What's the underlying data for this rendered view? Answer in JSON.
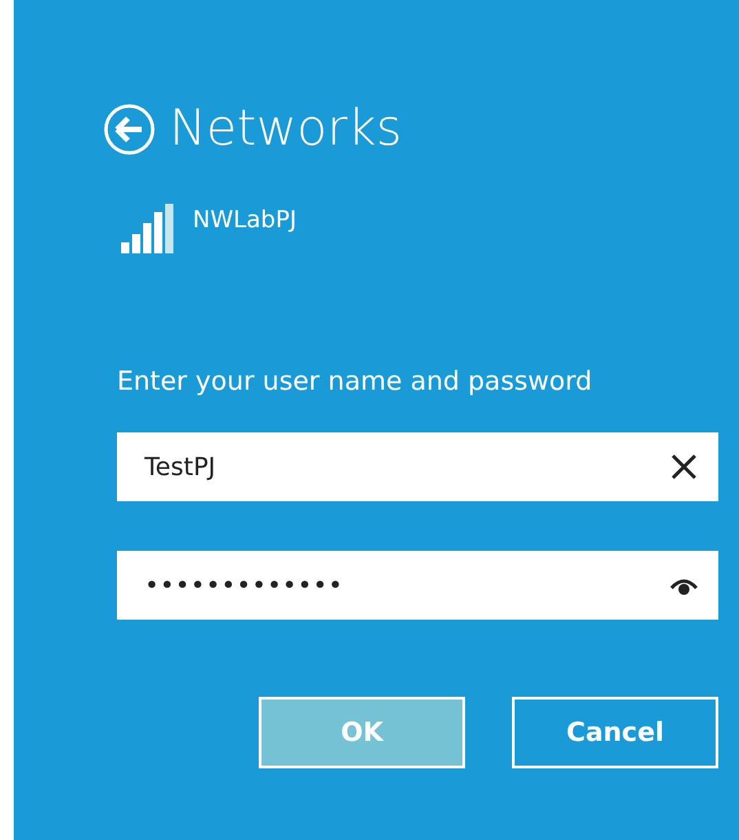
{
  "header": {
    "title": "Networks"
  },
  "network": {
    "name": "NWLabPJ"
  },
  "prompt": "Enter your user name and password",
  "fields": [
    {
      "kind": "text",
      "value": "TestPJ"
    },
    {
      "kind": "password",
      "value": "•••••••••••••"
    }
  ],
  "buttons": [
    {
      "label": "OK",
      "default": true
    },
    {
      "label": "Cancel",
      "default": false
    }
  ]
}
